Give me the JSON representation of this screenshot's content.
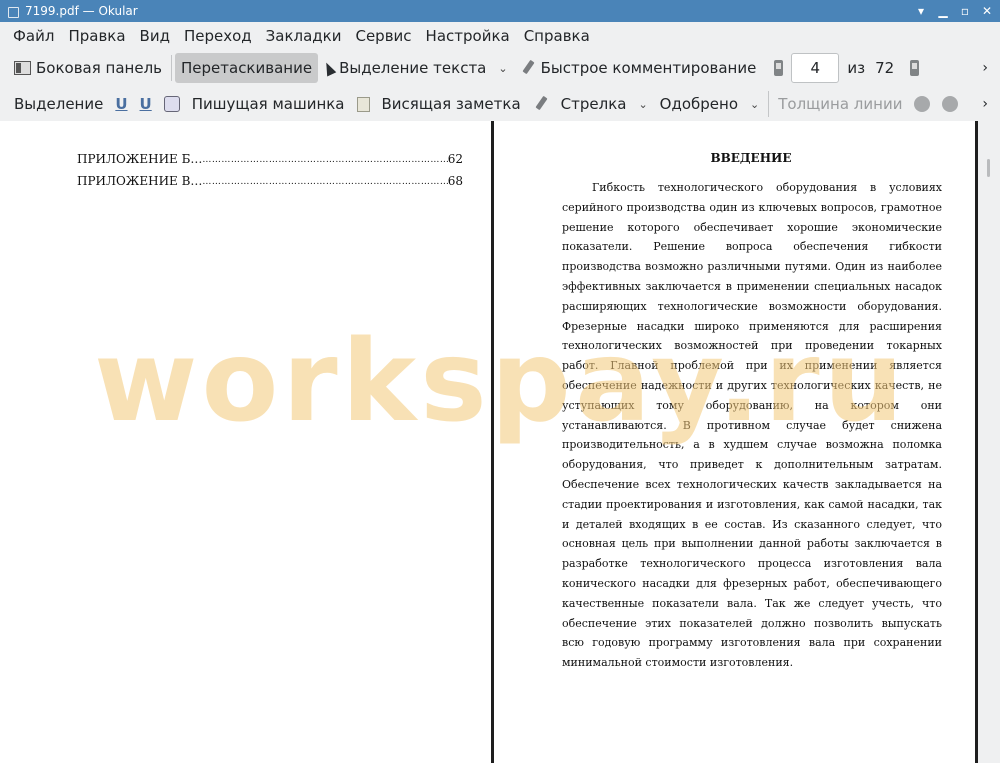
{
  "window": {
    "title": "7199.pdf  — Okular"
  },
  "menu": [
    "Файл",
    "Правка",
    "Вид",
    "Переход",
    "Закладки",
    "Сервис",
    "Настройка",
    "Справка"
  ],
  "toolbar1": {
    "sidebar": "Боковая панель",
    "browse": "Перетаскивание",
    "text_select": "Выделение текста",
    "quick_annot": "Быстрое комментирование",
    "page_current": "4",
    "page_of": "из",
    "page_total": "72"
  },
  "toolbar2": {
    "highlight": "Выделение",
    "typewriter": "Пишущая машинка",
    "popup_note": "Висящая заметка",
    "arrow": "Стрелка",
    "stamp": "Одобрено",
    "line_width": "Толщина линии"
  },
  "left_page": {
    "toc": [
      {
        "label": "ПРИЛОЖЕНИЕ Б…",
        "page": "62"
      },
      {
        "label": "ПРИЛОЖЕНИЕ В…",
        "page": "68"
      }
    ]
  },
  "right_page": {
    "heading": "ВВЕДЕНИЕ",
    "body": "Гибкость технологического оборудования в условиях серийного производства один из ключевых вопросов, грамотное решение которого обеспечивает хорошие экономические показатели. Решение вопроса обеспечения гибкости производства возможно различными путями. Один из наиболее эффективных заключается в применении специальных насадок расширяющих технологические возможности оборудования. Фрезерные насадки широко применяются для расширения технологических возможностей при проведении токарных работ. Главной проблемой при их применении является обеспечение надежности и других технологических качеств, не уступающих тому оборудованию, на котором они устанавливаются. В противном случае будет снижена производительность, а в худшем случае возможна поломка оборудования, что приведет к дополнительным затратам. Обеспечение всех технологических качеств закладывается на стадии проектирования и изготовления, как самой насадки, так и деталей входящих в ее состав. Из сказанного следует, что основная цель при выполнении данной работы заключается в разработке технологического процесса изготовления вала конического насадки для фрезерных работ, обеспечивающего качественные показатели вала. Так же следует учесть, что обеспечение этих показателей должно позволить выпускать всю годовую программу изготовления вала при сохранении минимальной стоимости изготовления."
  },
  "watermark": "workspay.ru",
  "icons": {
    "sidebar": "sidebar-icon",
    "text_select": "cursor-icon",
    "quick_annot": "pen-icon",
    "prev_page": "page-prev-icon",
    "next_page": "page-next-icon"
  },
  "colors": {
    "titlebar": "#4a84b8",
    "active_button": "#c9cacb",
    "watermark": "#f4c979"
  }
}
